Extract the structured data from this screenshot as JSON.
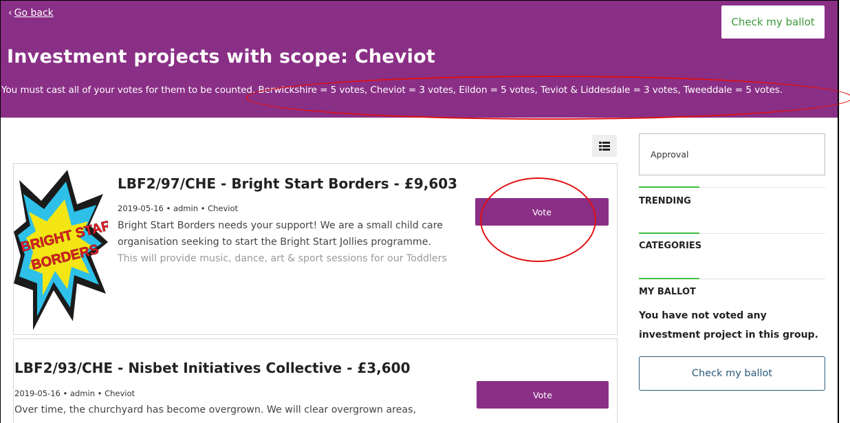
{
  "header": {
    "go_back_label": "Go back",
    "check_ballot_label": "Check my ballot",
    "title": "Investment projects with scope: Cheviot",
    "notice": "You must cast all of your votes for them to be counted. Berwickshire = 5 votes, Cheviot = 3 votes, Eildon = 5 votes, Teviot & Liddesdale = 3 votes, Tweeddale = 5 votes."
  },
  "projects": [
    {
      "title": "LBF2/97/CHE - Bright Start Borders - £9,603",
      "date": "2019-05-16",
      "author": "admin",
      "scope": "Cheviot",
      "description_lines": [
        "Bright Start Borders needs your support! We are a small child care",
        "organisation seeking to start the Bright Start Jollies programme.",
        "This will provide music, dance, art & sport sessions for our Toddlers"
      ],
      "logo_text_1": "BRIGHT START",
      "logo_text_2": "BORDERS",
      "vote_label": "Vote"
    },
    {
      "title": "LBF2/93/CHE - Nisbet Initiatives Collective - £3,600",
      "date": "2019-05-16",
      "author": "admin",
      "scope": "Cheviot",
      "description_lines": [
        "Over time, the churchyard has become overgrown. We will clear overgrown areas,"
      ],
      "vote_label": "Vote"
    }
  ],
  "sidebar": {
    "filter_value": "Approval",
    "trending_heading": "TRENDING",
    "categories_heading": "CATEGORIES",
    "ballot_heading": "MY BALLOT",
    "ballot_message": "You have not voted any investment project in this group.",
    "check_ballot_label": "Check my ballot"
  },
  "colors": {
    "brand_purple": "#8a2f86",
    "accent_green": "#3fbf3f",
    "annotation_red": "#e01010",
    "outline_blue": "#2a5b7a"
  },
  "icons": {
    "back": "chevron-left-icon",
    "view_toggle": "list-view-icon"
  }
}
